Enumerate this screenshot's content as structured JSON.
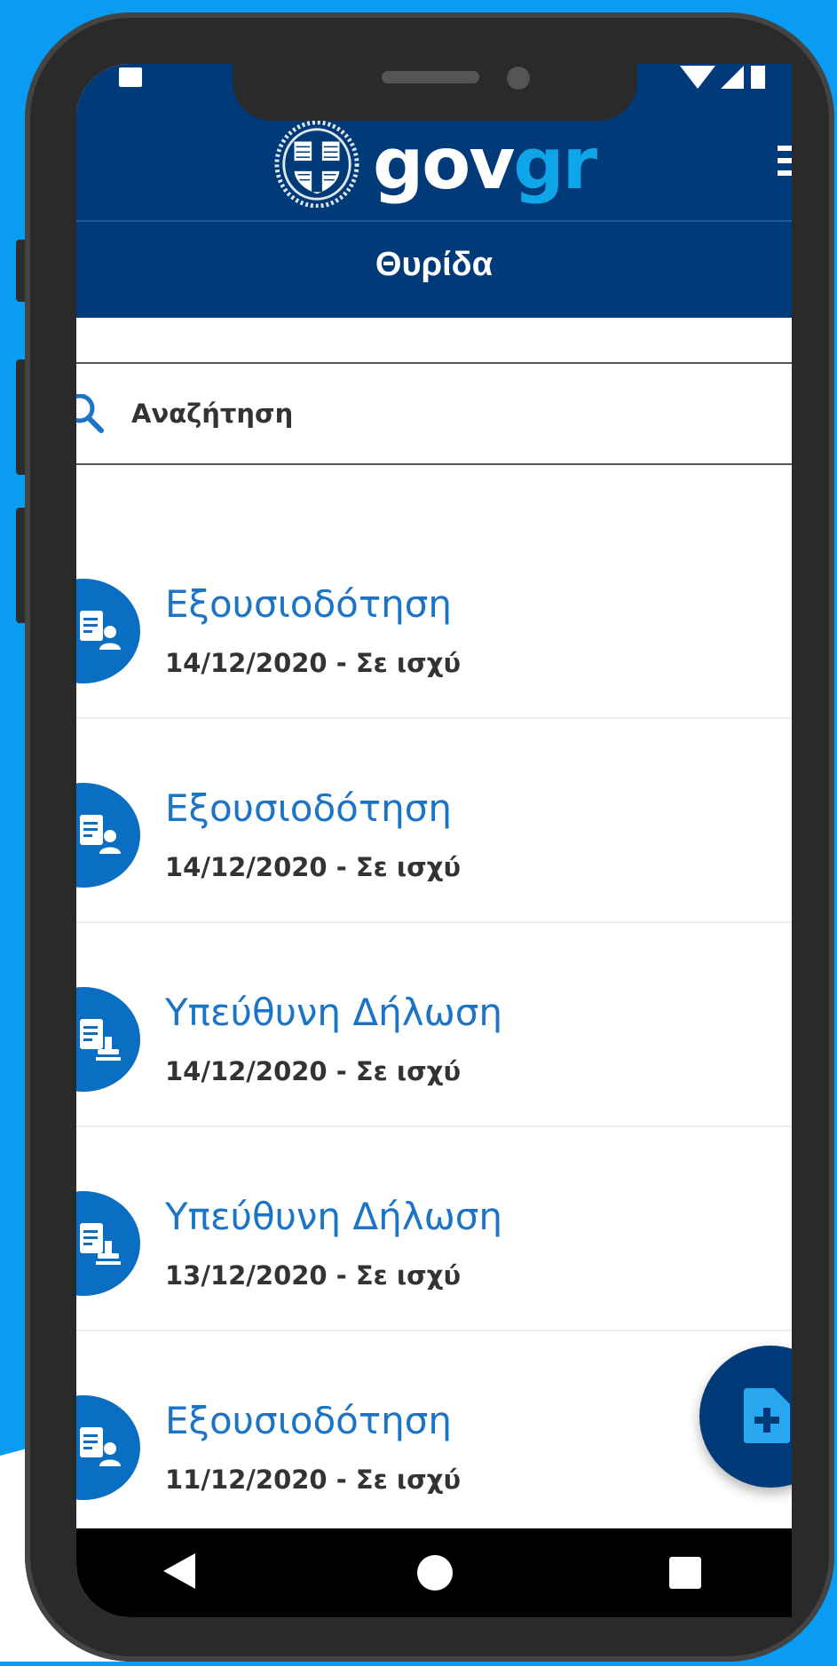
{
  "header": {
    "logo_gov": "gov",
    "logo_gr": "gr",
    "title": "Θυρίδα"
  },
  "search": {
    "placeholder": "Αναζήτηση"
  },
  "items": [
    {
      "title": "Εξουσιοδότηση",
      "subtitle": "14/12/2020 - Σε ισχύ",
      "icon": "authorization-document-icon"
    },
    {
      "title": "Εξουσιοδότηση",
      "subtitle": "14/12/2020 - Σε ισχύ",
      "icon": "authorization-document-icon"
    },
    {
      "title": "Υπεύθυνη Δήλωση",
      "subtitle": "14/12/2020 - Σε ισχύ",
      "icon": "stamped-declaration-icon"
    },
    {
      "title": "Υπεύθυνη Δήλωση",
      "subtitle": "13/12/2020 - Σε ισχύ",
      "icon": "stamped-declaration-icon"
    },
    {
      "title": "Εξουσιοδότηση",
      "subtitle": "11/12/2020 - Σε ισχύ",
      "icon": "authorization-document-icon"
    }
  ],
  "colors": {
    "background": "#0a9cf2",
    "header": "#003a78",
    "accent": "#0ea5e9",
    "item_title": "#1c74c6"
  }
}
